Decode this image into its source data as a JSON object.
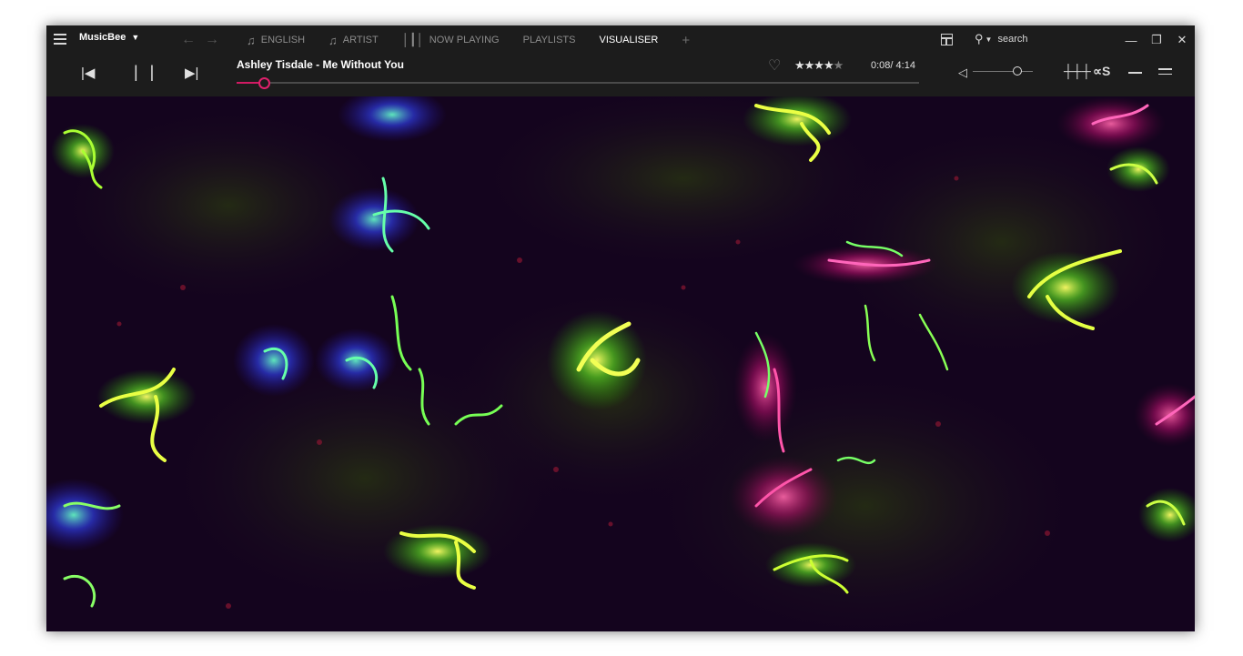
{
  "app": {
    "name": "MusicBee"
  },
  "tabs": [
    {
      "label": "ENGLISH",
      "icon": "music-note-icon"
    },
    {
      "label": "ARTIST",
      "icon": "music-note-icon"
    },
    {
      "label": "NOW PLAYING",
      "icon": "bars-icon"
    },
    {
      "label": "PLAYLISTS"
    },
    {
      "label": "VISUALISER",
      "active": true
    }
  ],
  "tab_add_label": "+",
  "search": {
    "label": "search"
  },
  "player": {
    "track": "Ashley Tisdale - Me Without You",
    "time": "0:08/ 4:14",
    "progress_percent": 4,
    "rating_stars": 4.5,
    "volume_percent": 75,
    "scrobble_label": "∝S"
  },
  "colors": {
    "accent": "#d11a63",
    "window_bg": "#1b1b1b",
    "visualiser_bg": "#12031c"
  }
}
